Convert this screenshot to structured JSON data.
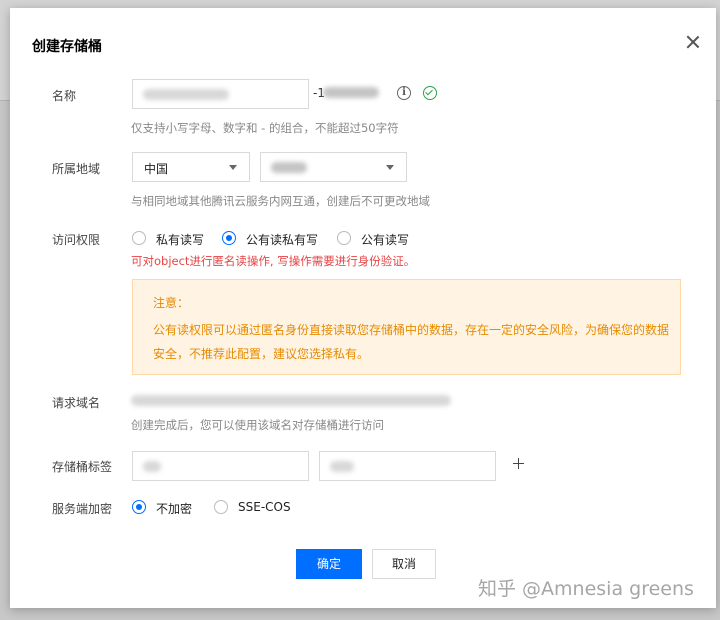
{
  "dialog": {
    "title": "创建存储桶"
  },
  "name_field": {
    "label": "名称",
    "suffix": "-1",
    "hint": "仅支持小写字母、数字和 - 的组合，不能超过50字符"
  },
  "region_field": {
    "label": "所属地域",
    "selected": "中国",
    "hint": "与相同地域其他腾讯云服务内网互通，创建后不可更改地域"
  },
  "access_field": {
    "label": "访问权限",
    "options": [
      "私有读写",
      "公有读私有写",
      "公有读写"
    ],
    "selected": "公有读私有写",
    "warning": "可对object进行匿名读操作, 写操作需要进行身份验证。"
  },
  "notice": {
    "title": "注意：",
    "body": "公有读权限可以通过匿名身份直接读取您存储桶中的数据，存在一定的安全风险，为确保您的数据安全，不推荐此配置，建议您选择私有。"
  },
  "domain_field": {
    "label": "请求域名",
    "hint": "创建完成后，您可以使用该域名对存储桶进行访问"
  },
  "tag_field": {
    "label": "存储桶标签"
  },
  "encryption_field": {
    "label": "服务端加密",
    "options": [
      "不加密",
      "SSE-COS"
    ],
    "selected": "不加密"
  },
  "footer": {
    "confirm_label": "确定",
    "cancel_label": "取消"
  },
  "watermark": "知乎 @Amnesia greens",
  "colors": {
    "primary": "#006eff",
    "warning_text": "#e54545",
    "notice_text": "#e68a00",
    "notice_bg": "#fff4e3",
    "success": "#29a34a"
  }
}
